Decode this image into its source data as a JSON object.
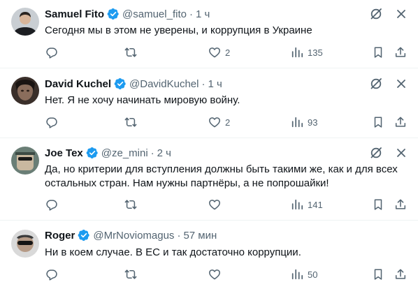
{
  "colors": {
    "verified": "#1d9bf0",
    "secondary": "#536471",
    "text": "#0f1419",
    "divider": "#eff3f4"
  },
  "icons": {
    "verified": "verified-badge-icon",
    "grok": "grok-icon",
    "more": "more-icon",
    "reply": "reply-icon",
    "retweet": "retweet-icon",
    "like": "like-icon",
    "views": "views-icon",
    "bookmark": "bookmark-icon",
    "share": "share-icon"
  },
  "tweets": [
    {
      "name": "Samuel Fito",
      "handle": "@samuel_fito",
      "separator": "·",
      "time": "1 ч",
      "text": "Сегодня мы в этом не уверены, и коррупция в Украине",
      "likes": "2",
      "views": "135"
    },
    {
      "name": "David Kuchel",
      "handle": "@DavidKuchel",
      "separator": "·",
      "time": "1 ч",
      "text": "Нет. Я не хочу начинать мировую войну.",
      "likes": "2",
      "views": "93"
    },
    {
      "name": "Joe Tex",
      "handle": "@ze_mini",
      "separator": "·",
      "time": "2 ч",
      "text": "Да, но критерии для вступления должны быть такими же, как и для всех остальных стран. Нам нужны партнёры, а не попрошайки!",
      "likes": "",
      "views": "141"
    },
    {
      "name": "Roger",
      "handle": "@MrNoviomagus",
      "separator": "·",
      "time": "57 мин",
      "text": "Ни в коем случае. В ЕС и так достаточно коррупции.",
      "likes": "",
      "views": "50"
    }
  ]
}
